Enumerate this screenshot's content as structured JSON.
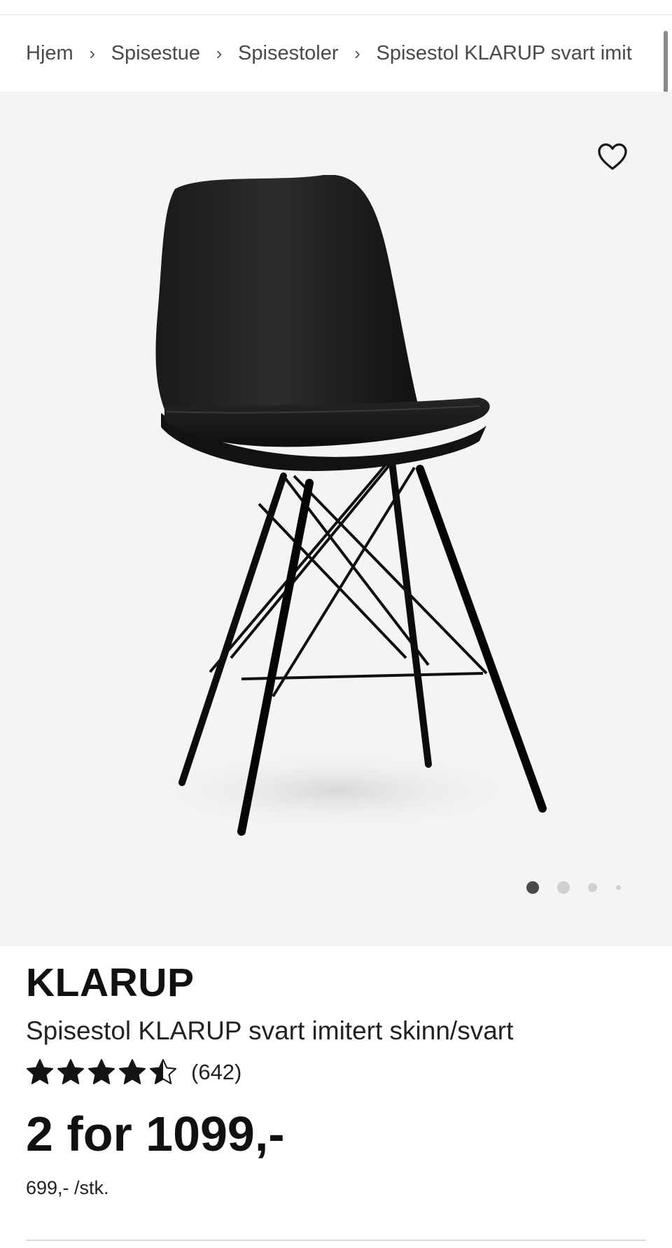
{
  "breadcrumb": {
    "items": [
      "Hjem",
      "Spisestue",
      "Spisestoler",
      "Spisestol KLARUP svart imit"
    ],
    "separator": "›"
  },
  "gallery": {
    "image_icon": "chair-icon",
    "wishlist_icon": "heart-icon",
    "current_slide": 1,
    "slide_count": 4
  },
  "product": {
    "brand": "KLARUP",
    "subtitle": "Spisestol KLARUP svart imitert skinn/svart",
    "rating": 4.5,
    "rating_max": 5,
    "reviews": "(642)",
    "price": "2 for 1099,-",
    "unit_price": "699,- /stk."
  },
  "colors": {
    "background": "#ffffff",
    "gallery_bg": "#f4f4f4",
    "text": "#141414",
    "dot_active": "#4a4a4a",
    "dot_inactive": "#d0d0d0"
  }
}
